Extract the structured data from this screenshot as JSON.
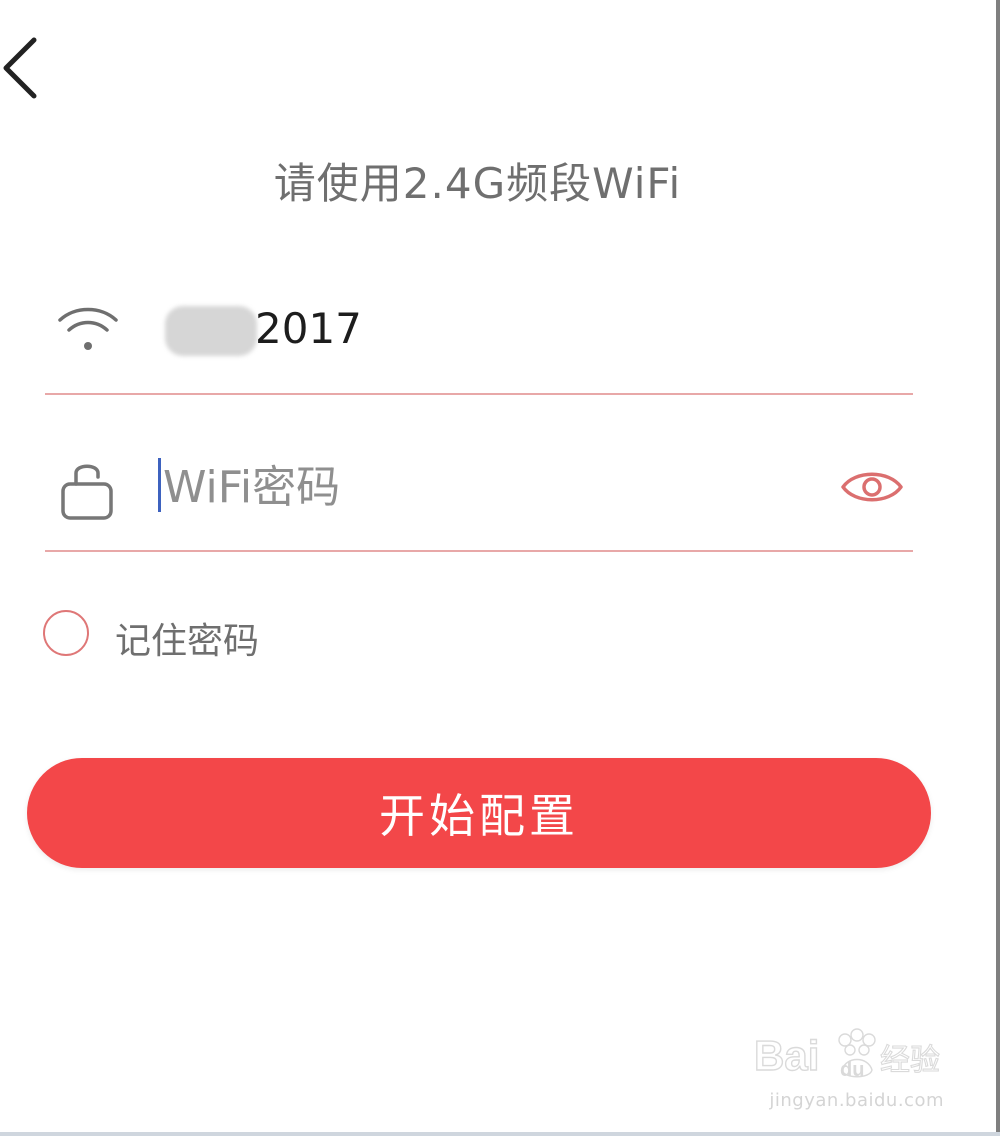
{
  "header": {
    "back_icon": "chevron-left-icon"
  },
  "hint_text": "请使用2.4G频段WiFi",
  "ssid": {
    "icon": "wifi-icon",
    "value": "2017"
  },
  "password": {
    "icon": "lock-icon",
    "placeholder": "WiFi密码",
    "value": "",
    "toggle_icon": "eye-icon"
  },
  "remember": {
    "checked": false,
    "label": "记住密码"
  },
  "start_button": {
    "label": "开始配置"
  },
  "watermark": {
    "logo_text": "Bai du 经验",
    "url": "jingyan.baidu.com"
  },
  "colors": {
    "primary": "#f34749",
    "divider": "#e8a8a8",
    "hint_text": "#6f6f6f",
    "placeholder": "#8f8f8f",
    "caret": "#3d62bf"
  }
}
